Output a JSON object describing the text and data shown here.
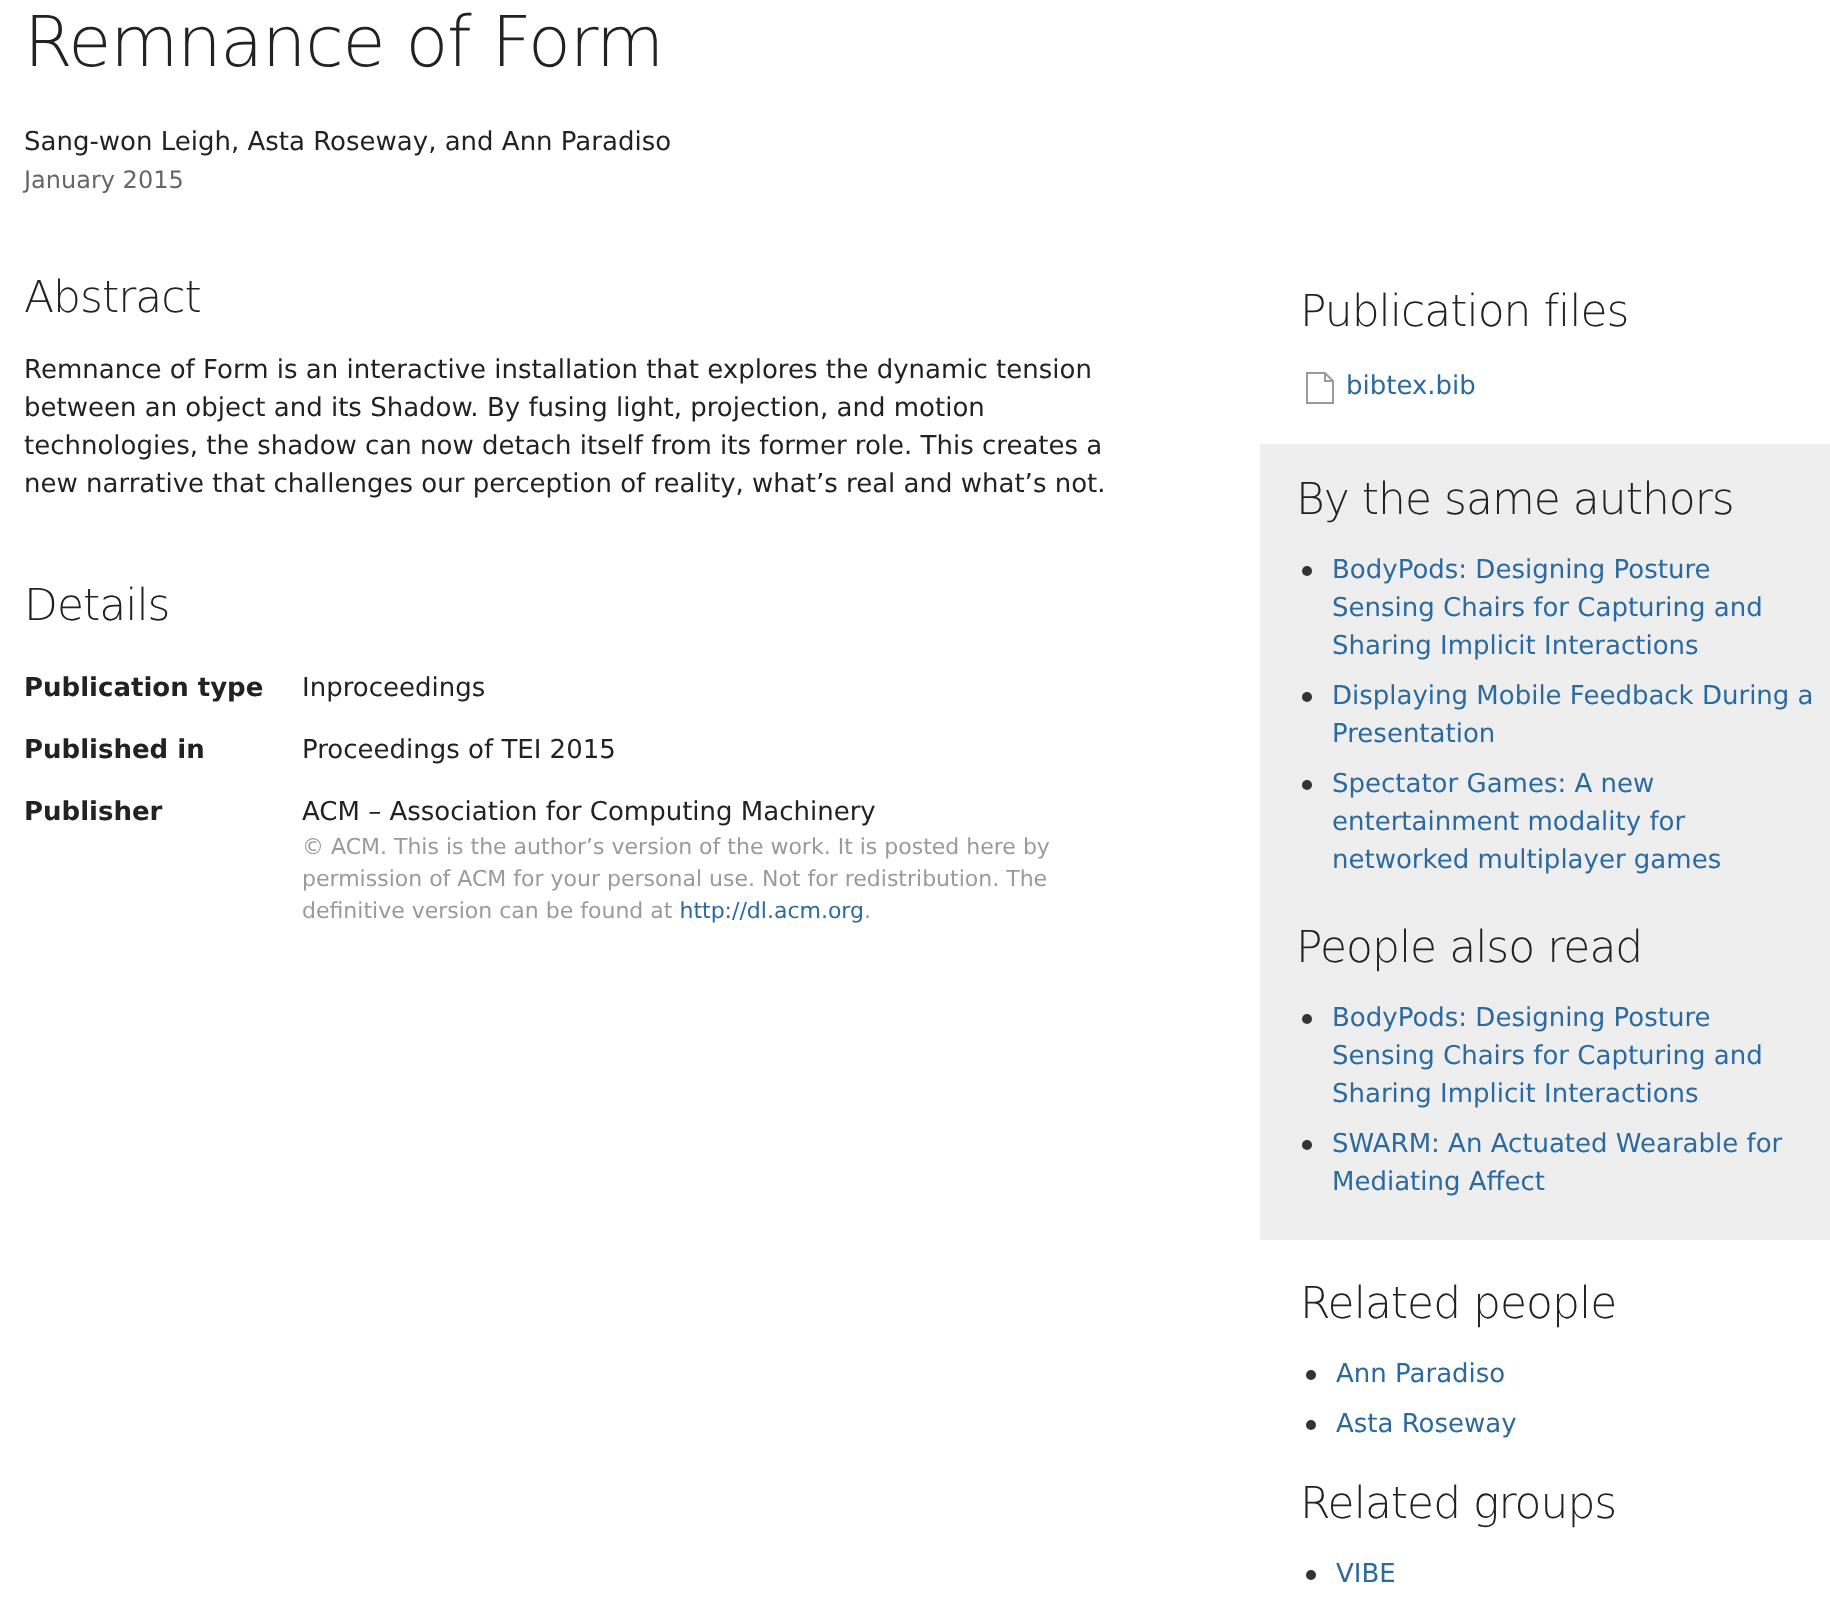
{
  "title": "Remnance of Form",
  "authors": "Sang-won Leigh, Asta Roseway, and Ann Paradiso",
  "date": "January 2015",
  "abstract": {
    "heading": "Abstract",
    "text": "Remnance of Form is an interactive installation that explores the dynamic tension between an object and its Shadow. By fusing light, projection, and motion technologies, the shadow can now detach itself from its former role. This creates a new narrative that challenges our perception of reality, what’s real and what’s not."
  },
  "details": {
    "heading": "Details",
    "rows": [
      {
        "label": "Publication type",
        "value": "Inproceedings"
      },
      {
        "label": "Published in",
        "value": "Proceedings of TEI 2015"
      },
      {
        "label": "Publisher",
        "value": "ACM – Association for Computing Machinery",
        "note": {
          "text": "© ACM. This is the author’s version of the work. It is posted here by permission of ACM for your personal use. Not for redistribution. The definitive version can be found at ",
          "link": "http://dl.acm.org",
          "after": "."
        }
      }
    ]
  },
  "publication_files": {
    "heading": "Publication files",
    "files": [
      "bibtex.bib"
    ]
  },
  "panel_sections": [
    {
      "heading": "By the same authors",
      "links": [
        "BodyPods: Designing Posture Sensing Chairs for Capturing and Sharing Implicit Interactions",
        "Displaying Mobile Feedback During a Presentation",
        "Spectator Games: A new entertainment modality for networked multiplayer games"
      ]
    },
    {
      "heading": "People also read",
      "links": [
        "BodyPods: Designing Posture Sensing Chairs for Capturing and Sharing Implicit Interactions",
        "SWARM: An Actuated Wearable for Mediating Affect"
      ]
    }
  ],
  "related_sections": [
    {
      "heading": "Related people",
      "links": [
        "Ann Paradiso",
        "Asta Roseway"
      ]
    },
    {
      "heading": "Related groups",
      "links": [
        "VIBE"
      ]
    }
  ]
}
